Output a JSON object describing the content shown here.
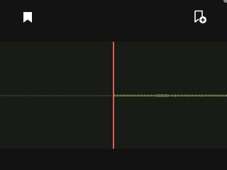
{
  "toolbar": {
    "left_icon": "bookmark-icon",
    "right_icon": "bookmark-add-icon",
    "icon_color": "#ffffff"
  },
  "waveform": {
    "played_color": "#4a5a3a",
    "unplayed_color": "#9ccc6a",
    "background": "#181b16"
  },
  "playhead": {
    "color": "#e35a52"
  }
}
